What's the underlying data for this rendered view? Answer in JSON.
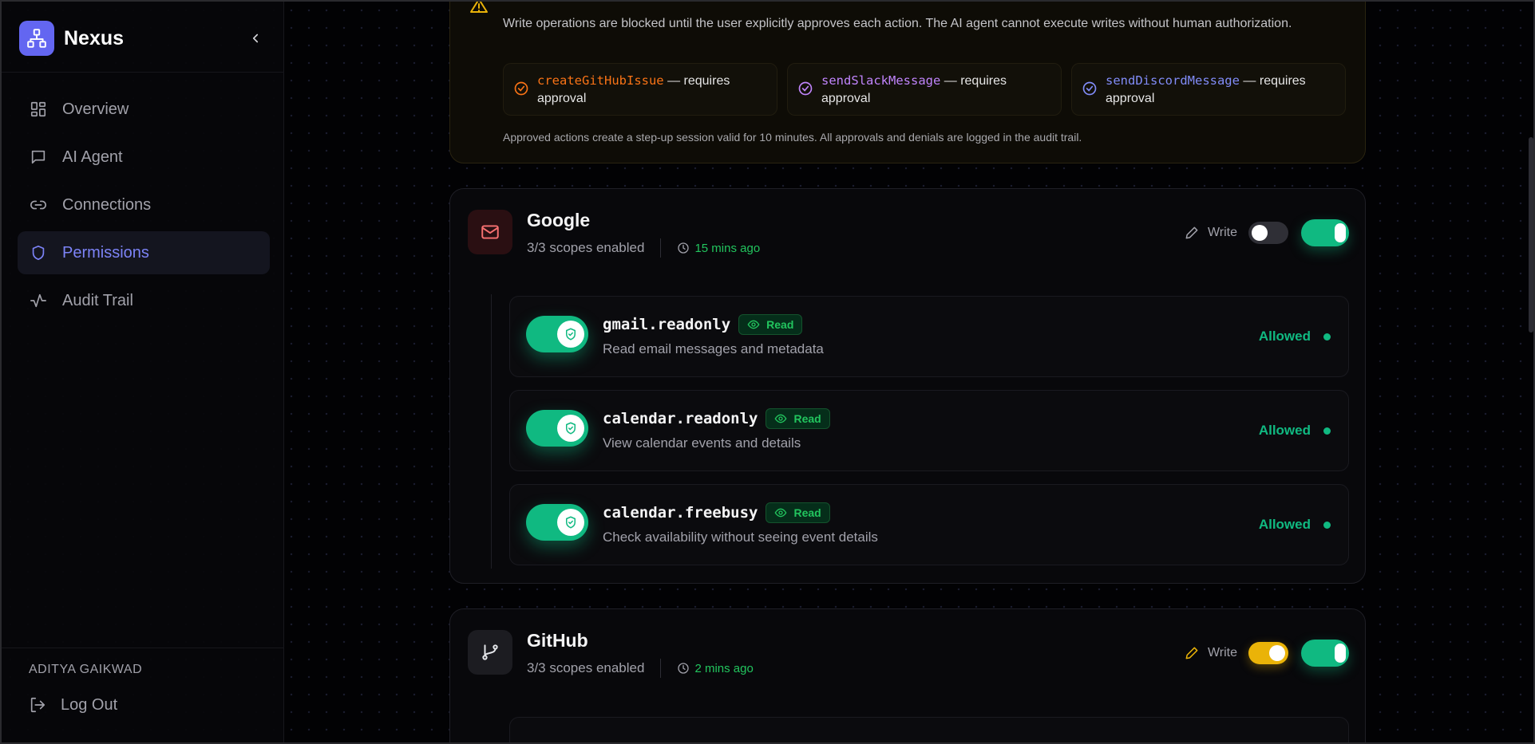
{
  "app": {
    "name": "Nexus"
  },
  "sidebar": {
    "items": [
      {
        "label": "Overview",
        "icon": "dashboard-icon",
        "active": false
      },
      {
        "label": "AI Agent",
        "icon": "chat-icon",
        "active": false
      },
      {
        "label": "Connections",
        "icon": "link-icon",
        "active": false
      },
      {
        "label": "Permissions",
        "icon": "shield-icon",
        "active": true
      },
      {
        "label": "Audit Trail",
        "icon": "activity-icon",
        "active": false
      }
    ],
    "user": "ADITYA GAIKWAD",
    "logout_label": "Log Out"
  },
  "stepup": {
    "description": "Write operations are blocked until the user explicitly approves each action. The AI agent cannot execute writes without human authorization.",
    "operations": [
      {
        "name": "createGitHubIssue",
        "suffix": " — requires approval",
        "color": "#f97316"
      },
      {
        "name": "sendSlackMessage",
        "suffix": " — requires approval",
        "color": "#c084fc"
      },
      {
        "name": "sendDiscordMessage",
        "suffix": " — requires approval",
        "color": "#818cf8"
      }
    ],
    "note": "Approved actions create a step-up session valid for 10 minutes. All approvals and denials are logged in the audit trail."
  },
  "services": {
    "google": {
      "name": "Google",
      "scopes_summary": "3/3 scopes enabled",
      "updated": "15 mins ago",
      "write_label": "Write",
      "write_enabled": false,
      "enabled": true,
      "scopes": [
        {
          "name": "gmail.readonly",
          "badge": "Read",
          "description": "Read email messages and metadata",
          "status": "Allowed"
        },
        {
          "name": "calendar.readonly",
          "badge": "Read",
          "description": "View calendar events and details",
          "status": "Allowed"
        },
        {
          "name": "calendar.freebusy",
          "badge": "Read",
          "description": "Check availability without seeing event details",
          "status": "Allowed"
        }
      ]
    },
    "github": {
      "name": "GitHub",
      "scopes_summary": "3/3 scopes enabled",
      "updated": "2 mins ago",
      "write_label": "Write",
      "write_enabled": true,
      "enabled": true
    }
  },
  "colors": {
    "accent": "#6366f1",
    "success": "#10b981",
    "warning": "#eab308"
  }
}
